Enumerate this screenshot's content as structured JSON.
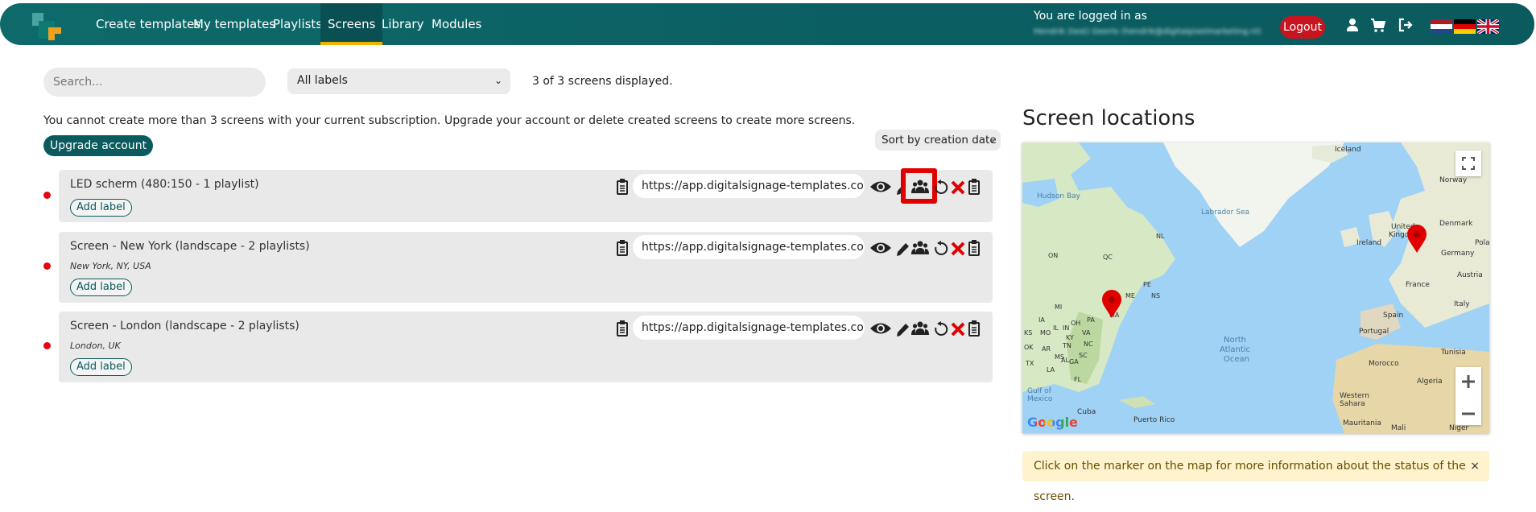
{
  "nav": {
    "items": [
      "Create templates",
      "My templates",
      "Playlists",
      "Screens",
      "Library",
      "Modules"
    ],
    "logged_in_text": "You are logged in as",
    "user": "Hendrik (test) Geerts (hendrik@digitalpixelmarketing.nl)",
    "logout_label": "Logout"
  },
  "toolbar": {
    "search_placeholder": "Search...",
    "labels_select": "All labels",
    "count_text": "3 of 3 screens displayed."
  },
  "notice": "You cannot create more than 3 screens with your current subscription. Upgrade your account or delete created screens to create more screens.",
  "upgrade_label": "Upgrade account",
  "sort_label": "Sort by creation date",
  "screens": [
    {
      "name": "LED scherm",
      "meta": "(480:150 - 1 playlist)",
      "location": "",
      "url": "https://app.digitalsignage-templates.co...",
      "add_label": "Add label"
    },
    {
      "name": "Screen -  New York",
      "meta": "(landscape - 2 playlists)",
      "location": "New York, NY, USA",
      "url": "https://app.digitalsignage-templates.co...",
      "add_label": "Add label"
    },
    {
      "name": "Screen -  London",
      "meta": "(landscape - 2 playlists)",
      "location": "London, UK",
      "url": "https://app.digitalsignage-templates.co...",
      "add_label": "Add label"
    }
  ],
  "map": {
    "title": "Screen locations",
    "labels": {
      "iceland": "Iceland",
      "hudson_bay": "Hudson Bay",
      "labrador_sea": "Labrador Sea",
      "norway": "Norway",
      "united": "United",
      "kingdom": "Kingdom",
      "denmark": "Denmark",
      "ireland": "Ireland",
      "germany": "Germany",
      "pola": "Pola",
      "france": "France",
      "austria": "Austria",
      "spain": "Spain",
      "italy": "Italy",
      "portugal": "Portugal",
      "tunisia": "Tunisia",
      "morocco": "Morocco",
      "algeria": "Algeria",
      "western_sahara": "Western Sahara",
      "mauritania": "Mauritania",
      "mali": "Mali",
      "niger": "Niger",
      "north": "North",
      "atlantic": "Atlantic",
      "ocean": "Ocean",
      "gulf": "Gulf of",
      "mexico": "Mexico",
      "cuba": "Cuba",
      "puerto_rico": "Puerto Rico",
      "nl": "NL",
      "on": "ON",
      "qc": "QC",
      "ns": "NS",
      "pe": "PE",
      "me": "ME",
      "ma": "MA",
      "pa": "PA",
      "oh": "OH",
      "ia": "IA",
      "mo": "MO",
      "ks": "KS",
      "tn": "TN",
      "nc": "NC",
      "sc": "SC",
      "al": "AL",
      "ga": "GA",
      "tx": "TX",
      "fl": "FL",
      "mi": "MI",
      "il": "IL",
      "in": "IN",
      "va": "VA",
      "ky": "KY",
      "ms": "MS",
      "la": "LA",
      "ar": "AR",
      "ok": "OK"
    },
    "google": "Google",
    "alert": "Click on the marker on the map for more information about the status of the screen.",
    "alert_close": "×"
  },
  "colors": {
    "brand": "#0b5a5e",
    "accent": "#f0b400",
    "danger": "#c8141e",
    "status_offline": "#e60012",
    "highlight": "#e00000"
  }
}
